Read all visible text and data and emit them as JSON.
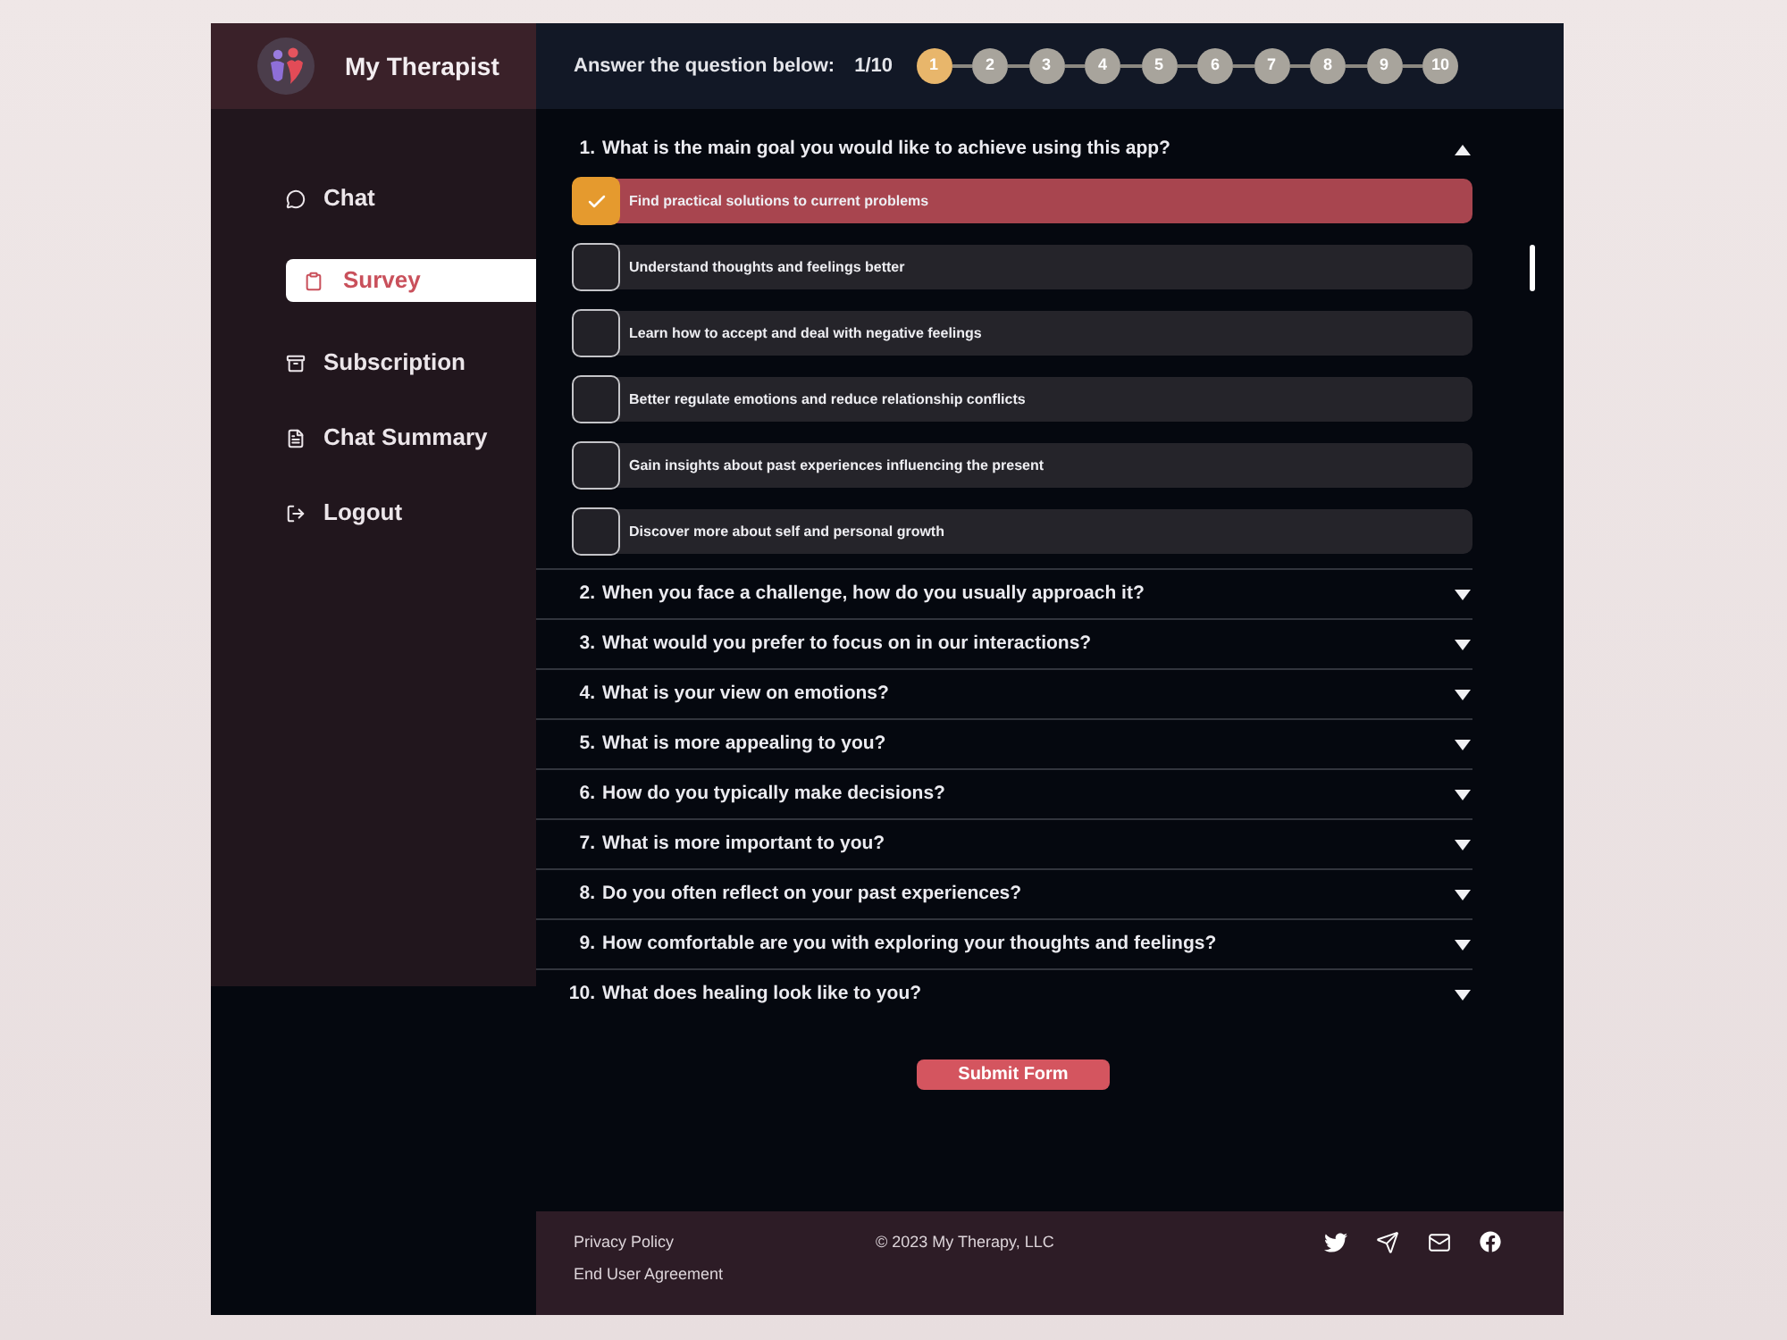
{
  "sidebar": {
    "brand": "My Therapist",
    "items": [
      {
        "label": "Chat",
        "selected": false
      },
      {
        "label": "Survey",
        "selected": true
      },
      {
        "label": "Subscription",
        "selected": false
      },
      {
        "label": "Chat Summary",
        "selected": false
      },
      {
        "label": "Logout",
        "selected": false
      }
    ]
  },
  "progress": {
    "prompt": "Answer the question below:",
    "counter": "1/10",
    "steps": [
      {
        "label": "1",
        "selected": true
      },
      {
        "label": "2",
        "selected": false
      },
      {
        "label": "3",
        "selected": false
      },
      {
        "label": "4",
        "selected": false
      },
      {
        "label": "5",
        "selected": false
      },
      {
        "label": "6",
        "selected": false
      },
      {
        "label": "7",
        "selected": false
      },
      {
        "label": "8",
        "selected": false
      },
      {
        "label": "9",
        "selected": false
      },
      {
        "label": "10",
        "selected": false
      }
    ]
  },
  "questions": [
    {
      "number": "1.",
      "text": "What is the main goal you would like to achieve using this app?",
      "expanded": true,
      "options": [
        {
          "label": "Find practical solutions to current problems",
          "checked": true
        },
        {
          "label": "Understand thoughts and feelings better",
          "checked": false
        },
        {
          "label": "Learn how to accept and deal with negative feelings",
          "checked": false
        },
        {
          "label": "Better regulate emotions and reduce relationship conflicts",
          "checked": false
        },
        {
          "label": "Gain insights about past experiences influencing the present",
          "checked": false
        },
        {
          "label": "Discover more about self and personal growth",
          "checked": false
        }
      ]
    },
    {
      "number": "2.",
      "text": "When you face a challenge, how do you usually approach it?",
      "expanded": false
    },
    {
      "number": "3.",
      "text": "What would you prefer to focus on in our interactions?",
      "expanded": false
    },
    {
      "number": "4.",
      "text": "What is your view on emotions?",
      "expanded": false
    },
    {
      "number": "5.",
      "text": "What is more appealing to you?",
      "expanded": false
    },
    {
      "number": "6.",
      "text": "How do you typically make decisions?",
      "expanded": false
    },
    {
      "number": "7.",
      "text": "What is more important to you?",
      "expanded": false
    },
    {
      "number": "8.",
      "text": "Do you often reflect on your past experiences?",
      "expanded": false
    },
    {
      "number": "9.",
      "text": "How comfortable are you with exploring your thoughts and feelings?",
      "expanded": false
    },
    {
      "number": "10.",
      "text": "What does healing look like to you?",
      "expanded": false
    }
  ],
  "submit_button": "Submit Form",
  "footer": {
    "links": [
      "Privacy Policy",
      "End User Agreement"
    ],
    "copyright": "© 2023 My Therapy, LLC"
  }
}
